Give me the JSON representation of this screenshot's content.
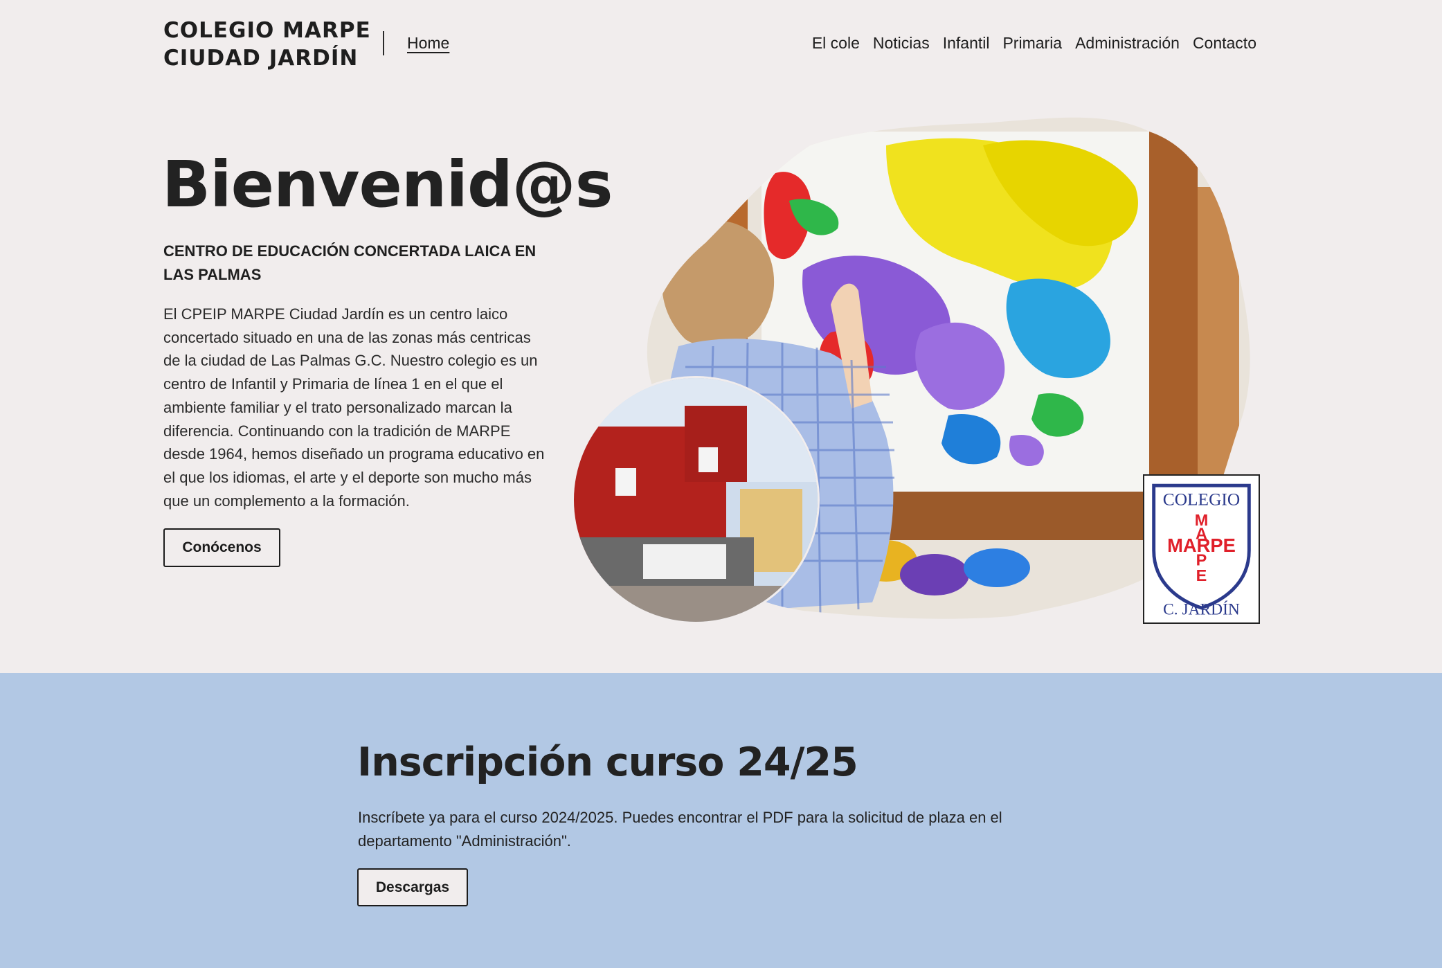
{
  "header": {
    "logo_line1": "COLEGIO MARPE",
    "logo_line2": "CIUDAD JARDÍN",
    "home_label": "Home",
    "nav": [
      "El cole",
      "Noticias",
      "Infantil",
      "Primaria",
      "Administración",
      "Contacto"
    ]
  },
  "hero": {
    "title": "Bienvenid@s",
    "subtitle": "CENTRO DE EDUCACIÓN CONCERTADA LAICA EN LAS PALMAS",
    "description": "El CPEIP MARPE Ciudad Jardín es un centro laico concertado situado en una de las zonas más centricas de la ciudad de Las Palmas G.C. Nuestro colegio es un centro de Infantil y Primaria de línea 1 en el que el ambiente familiar y el trato personalizado marcan la diferencia. Continuando con la tradición de MARPE desde 1964, hemos diseñado un programa educativo en el que los idiomas, el arte y el deporte son mucho más que un complemento a la formación.",
    "button_label": "Conócenos"
  },
  "school_logo": {
    "top_text": "COLEGIO",
    "word_horizontal": "MARPE",
    "bottom_text": "C. JARDÍN",
    "navy": "#2b3a8c",
    "red": "#e0202a"
  },
  "inscription": {
    "title": "Inscripción curso 24/25",
    "text": "Inscríbete ya para el curso 2024/2025. Puedes encontrar el PDF para la solicitud de plaza en el departamento \"Administración\".",
    "button_label": "Descargas"
  },
  "colors": {
    "page_bg": "#f1eded",
    "section_bg": "#b2c8e4",
    "text": "#1f1f1f"
  }
}
